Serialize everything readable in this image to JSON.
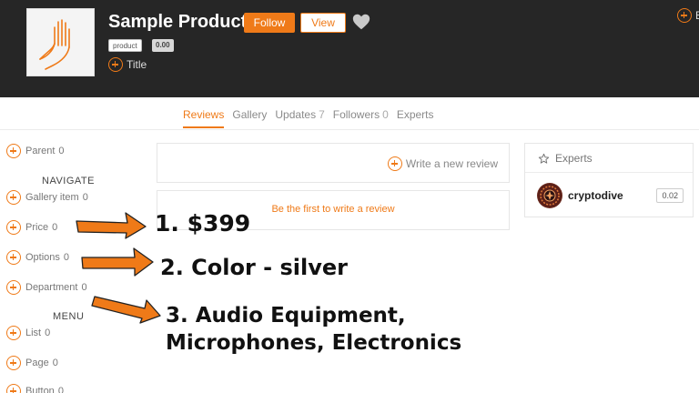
{
  "header": {
    "product_title": "Sample Product",
    "follow_label": "Follow",
    "view_label": "View",
    "category_badge": "product",
    "price_badge": "0.00",
    "add_title_label": "Title",
    "right_action_label": "E"
  },
  "tabs": [
    {
      "label": "Reviews",
      "count": ""
    },
    {
      "label": "Gallery",
      "count": ""
    },
    {
      "label": "Updates",
      "count": "7"
    },
    {
      "label": "Followers",
      "count": "0"
    },
    {
      "label": "Experts",
      "count": ""
    }
  ],
  "sidebar": {
    "parent": {
      "label": "Parent",
      "count": "0"
    },
    "navigate_heading": "NAVIGATE",
    "navigate_items": [
      {
        "label": "Gallery item",
        "count": "0"
      },
      {
        "label": "Price",
        "count": "0"
      },
      {
        "label": "Options",
        "count": "0"
      },
      {
        "label": "Department",
        "count": "0"
      }
    ],
    "menu_heading": "MENU",
    "menu_items": [
      {
        "label": "List",
        "count": "0"
      },
      {
        "label": "Page",
        "count": "0"
      },
      {
        "label": "Button",
        "count": "0"
      }
    ]
  },
  "reviews": {
    "write_review_label": "Write a new review",
    "empty_message": "Be the first to write a review"
  },
  "experts": {
    "heading": "Experts",
    "items": [
      {
        "name": "cryptodive",
        "score": "0.02"
      }
    ]
  },
  "annotations": {
    "line1": "1. $399",
    "line2": "2. Color - silver",
    "line3a": "3. Audio Equipment,",
    "line3b": "Microphones, Electronics"
  },
  "colors": {
    "accent": "#ef7a18",
    "header_bg": "#262626"
  }
}
